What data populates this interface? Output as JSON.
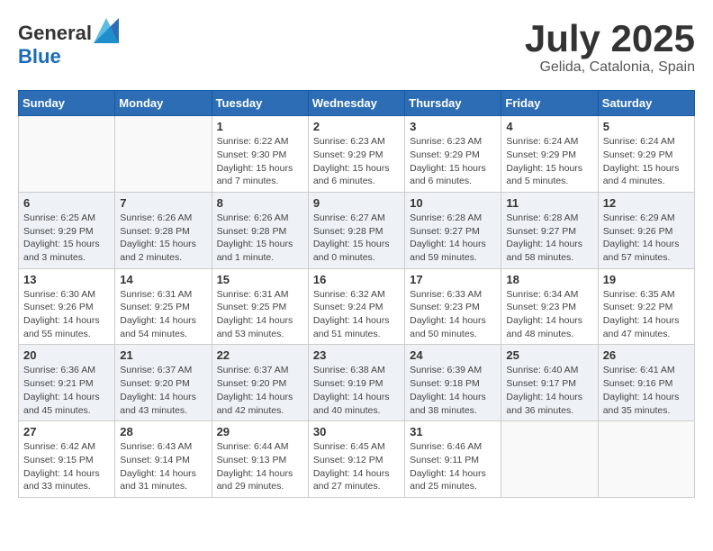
{
  "header": {
    "logo_general": "General",
    "logo_blue": "Blue",
    "month": "July 2025",
    "location": "Gelida, Catalonia, Spain"
  },
  "weekdays": [
    "Sunday",
    "Monday",
    "Tuesday",
    "Wednesday",
    "Thursday",
    "Friday",
    "Saturday"
  ],
  "weeks": [
    [
      {
        "day": "",
        "info": ""
      },
      {
        "day": "",
        "info": ""
      },
      {
        "day": "1",
        "info": "Sunrise: 6:22 AM\nSunset: 9:30 PM\nDaylight: 15 hours and 7 minutes."
      },
      {
        "day": "2",
        "info": "Sunrise: 6:23 AM\nSunset: 9:29 PM\nDaylight: 15 hours and 6 minutes."
      },
      {
        "day": "3",
        "info": "Sunrise: 6:23 AM\nSunset: 9:29 PM\nDaylight: 15 hours and 6 minutes."
      },
      {
        "day": "4",
        "info": "Sunrise: 6:24 AM\nSunset: 9:29 PM\nDaylight: 15 hours and 5 minutes."
      },
      {
        "day": "5",
        "info": "Sunrise: 6:24 AM\nSunset: 9:29 PM\nDaylight: 15 hours and 4 minutes."
      }
    ],
    [
      {
        "day": "6",
        "info": "Sunrise: 6:25 AM\nSunset: 9:29 PM\nDaylight: 15 hours and 3 minutes."
      },
      {
        "day": "7",
        "info": "Sunrise: 6:26 AM\nSunset: 9:28 PM\nDaylight: 15 hours and 2 minutes."
      },
      {
        "day": "8",
        "info": "Sunrise: 6:26 AM\nSunset: 9:28 PM\nDaylight: 15 hours and 1 minute."
      },
      {
        "day": "9",
        "info": "Sunrise: 6:27 AM\nSunset: 9:28 PM\nDaylight: 15 hours and 0 minutes."
      },
      {
        "day": "10",
        "info": "Sunrise: 6:28 AM\nSunset: 9:27 PM\nDaylight: 14 hours and 59 minutes."
      },
      {
        "day": "11",
        "info": "Sunrise: 6:28 AM\nSunset: 9:27 PM\nDaylight: 14 hours and 58 minutes."
      },
      {
        "day": "12",
        "info": "Sunrise: 6:29 AM\nSunset: 9:26 PM\nDaylight: 14 hours and 57 minutes."
      }
    ],
    [
      {
        "day": "13",
        "info": "Sunrise: 6:30 AM\nSunset: 9:26 PM\nDaylight: 14 hours and 55 minutes."
      },
      {
        "day": "14",
        "info": "Sunrise: 6:31 AM\nSunset: 9:25 PM\nDaylight: 14 hours and 54 minutes."
      },
      {
        "day": "15",
        "info": "Sunrise: 6:31 AM\nSunset: 9:25 PM\nDaylight: 14 hours and 53 minutes."
      },
      {
        "day": "16",
        "info": "Sunrise: 6:32 AM\nSunset: 9:24 PM\nDaylight: 14 hours and 51 minutes."
      },
      {
        "day": "17",
        "info": "Sunrise: 6:33 AM\nSunset: 9:23 PM\nDaylight: 14 hours and 50 minutes."
      },
      {
        "day": "18",
        "info": "Sunrise: 6:34 AM\nSunset: 9:23 PM\nDaylight: 14 hours and 48 minutes."
      },
      {
        "day": "19",
        "info": "Sunrise: 6:35 AM\nSunset: 9:22 PM\nDaylight: 14 hours and 47 minutes."
      }
    ],
    [
      {
        "day": "20",
        "info": "Sunrise: 6:36 AM\nSunset: 9:21 PM\nDaylight: 14 hours and 45 minutes."
      },
      {
        "day": "21",
        "info": "Sunrise: 6:37 AM\nSunset: 9:20 PM\nDaylight: 14 hours and 43 minutes."
      },
      {
        "day": "22",
        "info": "Sunrise: 6:37 AM\nSunset: 9:20 PM\nDaylight: 14 hours and 42 minutes."
      },
      {
        "day": "23",
        "info": "Sunrise: 6:38 AM\nSunset: 9:19 PM\nDaylight: 14 hours and 40 minutes."
      },
      {
        "day": "24",
        "info": "Sunrise: 6:39 AM\nSunset: 9:18 PM\nDaylight: 14 hours and 38 minutes."
      },
      {
        "day": "25",
        "info": "Sunrise: 6:40 AM\nSunset: 9:17 PM\nDaylight: 14 hours and 36 minutes."
      },
      {
        "day": "26",
        "info": "Sunrise: 6:41 AM\nSunset: 9:16 PM\nDaylight: 14 hours and 35 minutes."
      }
    ],
    [
      {
        "day": "27",
        "info": "Sunrise: 6:42 AM\nSunset: 9:15 PM\nDaylight: 14 hours and 33 minutes."
      },
      {
        "day": "28",
        "info": "Sunrise: 6:43 AM\nSunset: 9:14 PM\nDaylight: 14 hours and 31 minutes."
      },
      {
        "day": "29",
        "info": "Sunrise: 6:44 AM\nSunset: 9:13 PM\nDaylight: 14 hours and 29 minutes."
      },
      {
        "day": "30",
        "info": "Sunrise: 6:45 AM\nSunset: 9:12 PM\nDaylight: 14 hours and 27 minutes."
      },
      {
        "day": "31",
        "info": "Sunrise: 6:46 AM\nSunset: 9:11 PM\nDaylight: 14 hours and 25 minutes."
      },
      {
        "day": "",
        "info": ""
      },
      {
        "day": "",
        "info": ""
      }
    ]
  ]
}
